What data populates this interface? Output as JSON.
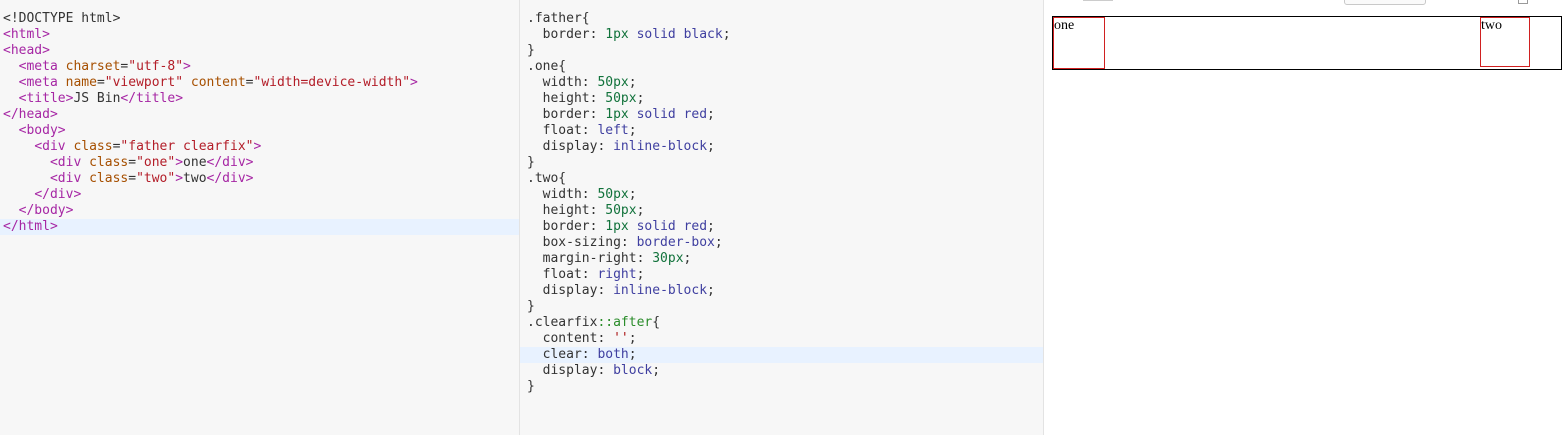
{
  "html_editor": {
    "lines": [
      [
        [
          "<!DOCTYPE html>",
          "sel"
        ]
      ],
      [
        [
          "<html>",
          "tag"
        ]
      ],
      [
        [
          "<head>",
          "tag"
        ]
      ],
      [
        [
          "  ",
          ""
        ],
        [
          "<meta ",
          "tag"
        ],
        [
          "charset",
          "an"
        ],
        [
          "=",
          ""
        ],
        [
          "\"utf-8\"",
          "av"
        ],
        [
          ">",
          "tag"
        ]
      ],
      [
        [
          "  ",
          ""
        ],
        [
          "<meta ",
          "tag"
        ],
        [
          "name",
          "an"
        ],
        [
          "=",
          ""
        ],
        [
          "\"viewport\"",
          "av"
        ],
        [
          " ",
          ""
        ],
        [
          "content",
          "an"
        ],
        [
          "=",
          ""
        ],
        [
          "\"width=device-width\"",
          "av"
        ],
        [
          ">",
          "tag"
        ]
      ],
      [
        [
          "  ",
          ""
        ],
        [
          "<title>",
          "tag"
        ],
        [
          "JS Bin",
          ""
        ],
        [
          "</title>",
          "tag"
        ]
      ],
      [
        [
          "</head>",
          "tag"
        ]
      ],
      [
        [
          "  ",
          ""
        ],
        [
          "<body>",
          "tag"
        ]
      ],
      [
        [
          "    ",
          ""
        ],
        [
          "<div ",
          "tag"
        ],
        [
          "class",
          "an"
        ],
        [
          "=",
          ""
        ],
        [
          "\"father clearfix\"",
          "av"
        ],
        [
          ">",
          "tag"
        ]
      ],
      [
        [
          "      ",
          ""
        ],
        [
          "<div ",
          "tag"
        ],
        [
          "class",
          "an"
        ],
        [
          "=",
          ""
        ],
        [
          "\"one\"",
          "av"
        ],
        [
          ">",
          "tag"
        ],
        [
          "one",
          ""
        ],
        [
          "</div>",
          "tag"
        ]
      ],
      [
        [
          "      ",
          ""
        ],
        [
          "<div ",
          "tag"
        ],
        [
          "class",
          "an"
        ],
        [
          "=",
          ""
        ],
        [
          "\"two\"",
          "av"
        ],
        [
          ">",
          "tag"
        ],
        [
          "two",
          ""
        ],
        [
          "</div>",
          "tag"
        ]
      ],
      [
        [
          "    ",
          ""
        ],
        [
          "</div>",
          "tag"
        ]
      ],
      [
        [
          "  ",
          ""
        ],
        [
          "</body>",
          "tag"
        ]
      ],
      [
        [
          "</html>",
          "tag"
        ]
      ]
    ],
    "active_line": 13
  },
  "css_editor": {
    "lines": [
      [
        [
          ".father{",
          "sel"
        ]
      ],
      [
        [
          "  border",
          "prop"
        ],
        [
          ": ",
          ""
        ],
        [
          "1px",
          "num"
        ],
        [
          " ",
          ""
        ],
        [
          "solid",
          "kw"
        ],
        [
          " ",
          ""
        ],
        [
          "black",
          "kw"
        ],
        [
          ";",
          ""
        ]
      ],
      [
        [
          "}",
          ""
        ]
      ],
      [
        [
          ".one{",
          "sel"
        ]
      ],
      [
        [
          "  width",
          "prop"
        ],
        [
          ": ",
          ""
        ],
        [
          "50px",
          "num"
        ],
        [
          ";",
          ""
        ]
      ],
      [
        [
          "  height",
          "prop"
        ],
        [
          ": ",
          ""
        ],
        [
          "50px",
          "num"
        ],
        [
          ";",
          ""
        ]
      ],
      [
        [
          "  border",
          "prop"
        ],
        [
          ": ",
          ""
        ],
        [
          "1px",
          "num"
        ],
        [
          " ",
          ""
        ],
        [
          "solid",
          "kw"
        ],
        [
          " ",
          ""
        ],
        [
          "red",
          "kw"
        ],
        [
          ";",
          ""
        ]
      ],
      [
        [
          "  float",
          "prop"
        ],
        [
          ": ",
          ""
        ],
        [
          "left",
          "kw"
        ],
        [
          ";",
          ""
        ]
      ],
      [
        [
          "  display",
          "prop"
        ],
        [
          ": ",
          ""
        ],
        [
          "inline-block",
          "kw"
        ],
        [
          ";",
          ""
        ]
      ],
      [
        [
          "}",
          ""
        ]
      ],
      [
        [
          ".two{",
          "sel"
        ]
      ],
      [
        [
          "  width",
          "prop"
        ],
        [
          ": ",
          ""
        ],
        [
          "50px",
          "num"
        ],
        [
          ";",
          ""
        ]
      ],
      [
        [
          "  height",
          "prop"
        ],
        [
          ": ",
          ""
        ],
        [
          "50px",
          "num"
        ],
        [
          ";",
          ""
        ]
      ],
      [
        [
          "  border",
          "prop"
        ],
        [
          ": ",
          ""
        ],
        [
          "1px",
          "num"
        ],
        [
          " ",
          ""
        ],
        [
          "solid",
          "kw"
        ],
        [
          " ",
          ""
        ],
        [
          "red",
          "kw"
        ],
        [
          ";",
          ""
        ]
      ],
      [
        [
          "  box-sizing",
          "prop"
        ],
        [
          ": ",
          ""
        ],
        [
          "border-box",
          "kw"
        ],
        [
          ";",
          ""
        ]
      ],
      [
        [
          "  margin-right",
          "prop"
        ],
        [
          ": ",
          ""
        ],
        [
          "30px",
          "num"
        ],
        [
          ";",
          ""
        ]
      ],
      [
        [
          "  float",
          "prop"
        ],
        [
          ": ",
          ""
        ],
        [
          "right",
          "kw"
        ],
        [
          ";",
          ""
        ]
      ],
      [
        [
          "  display",
          "prop"
        ],
        [
          ": ",
          ""
        ],
        [
          "inline-block",
          "kw"
        ],
        [
          ";",
          ""
        ]
      ],
      [
        [
          "}",
          ""
        ]
      ],
      [
        [
          ".clearfix",
          "sel"
        ],
        [
          "::after",
          "pseudo"
        ],
        [
          "{",
          ""
        ]
      ],
      [
        [
          "  content",
          "prop"
        ],
        [
          ": ",
          ""
        ],
        [
          "''",
          "str"
        ],
        [
          ";",
          ""
        ]
      ],
      [
        [
          "  clear",
          "prop"
        ],
        [
          ": ",
          ""
        ],
        [
          "both",
          "kw"
        ],
        [
          ";",
          ""
        ]
      ],
      [
        [
          "  display",
          "prop"
        ],
        [
          ": ",
          ""
        ],
        [
          "block",
          "kw"
        ],
        [
          ";",
          ""
        ]
      ],
      [
        [
          "}",
          ""
        ]
      ]
    ],
    "active_line": 21
  },
  "output": {
    "box_one_text": "one",
    "box_two_text": "two"
  },
  "colors": {
    "tag": "#a626a4",
    "attribute_name": "#a64f00",
    "attribute_value": "#b31d28",
    "number": "#11723b",
    "keyword": "#3f3fa0",
    "string": "#aa1111",
    "pseudo": "#2a8c2a",
    "active_line": "#e8f2ff",
    "output_box_border": "#d02020",
    "output_father_border": "#000000"
  }
}
